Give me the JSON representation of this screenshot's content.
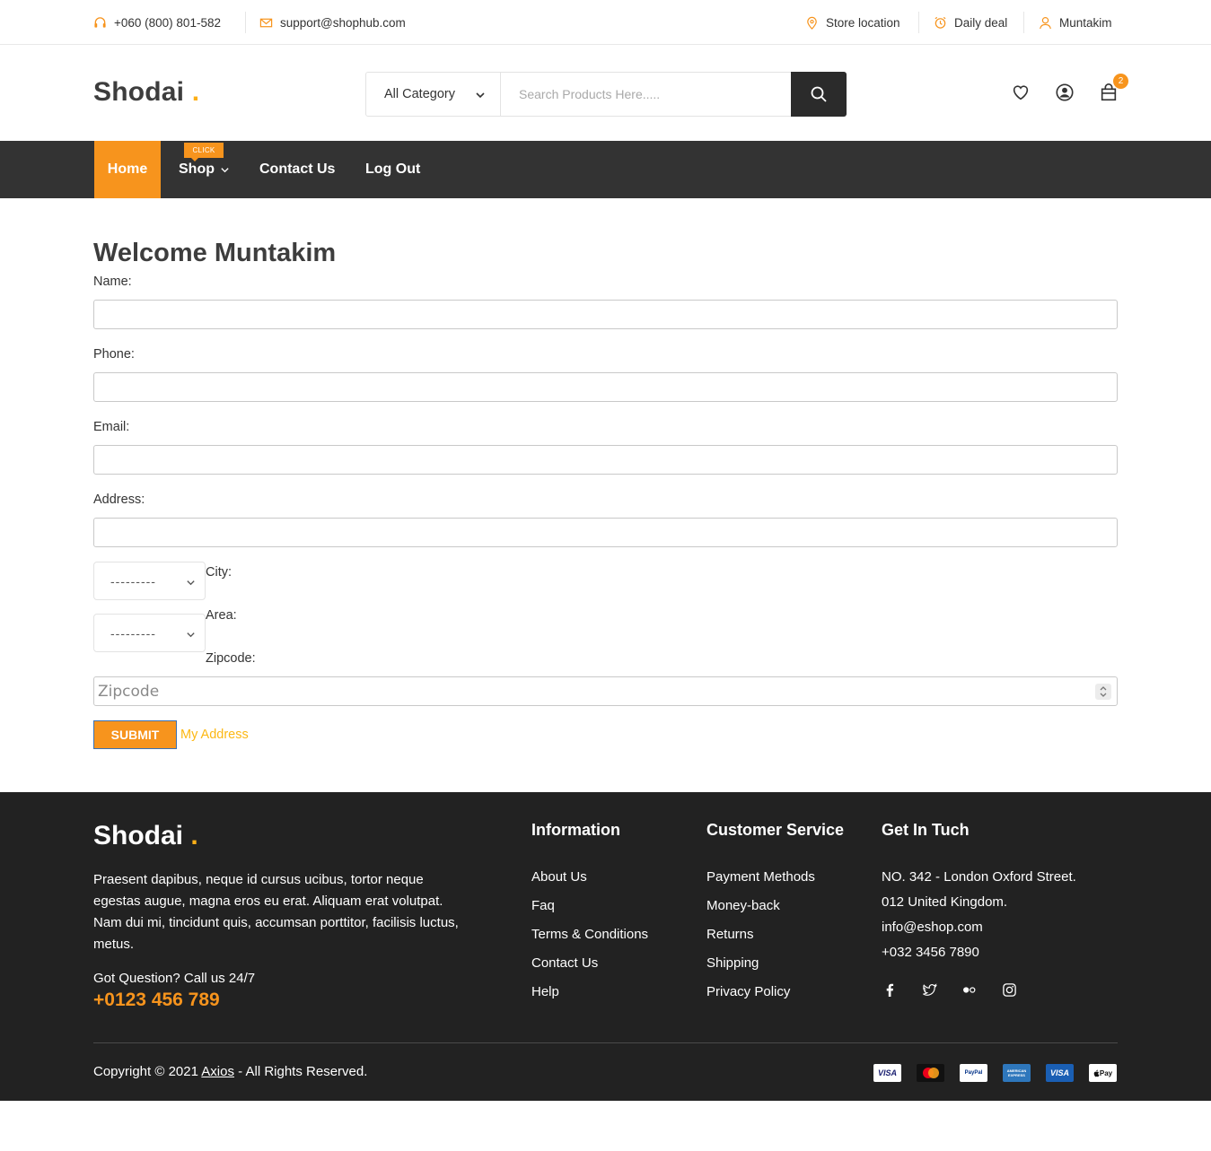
{
  "topbar": {
    "phone": "+060 (800) 801-582",
    "email": "support@shophub.com",
    "store_location": "Store location",
    "daily_deal": "Daily deal",
    "user": "Muntakim"
  },
  "header": {
    "logo": "Shodai",
    "logo_dot": ".",
    "category": "All Category",
    "search_placeholder": "Search Products Here.....",
    "cart_count": "2"
  },
  "nav": {
    "home": "Home",
    "shop": "Shop",
    "shop_badge": "CLICK",
    "contact": "Contact Us",
    "logout": "Log Out"
  },
  "form": {
    "title": "Welcome Muntakim",
    "name_label": "Name:",
    "phone_label": "Phone:",
    "email_label": "Email:",
    "address_label": "Address:",
    "city_select": "---------",
    "city_label": "City:",
    "area_select": "---------",
    "area_label": "Area:",
    "zipcode_label": "Zipcode:",
    "zipcode_placeholder": "Zipcode",
    "submit": "SUBMIT",
    "my_address": "My Address"
  },
  "footer": {
    "logo": "Shodai",
    "logo_dot": ".",
    "about": "Praesent dapibus, neque id cursus ucibus, tortor neque egestas augue, magna eros eu erat. Aliquam erat volutpat. Nam dui mi, tincidunt quis, accumsan porttitor, facilisis luctus, metus.",
    "question": "Got Question? Call us 24/7",
    "phone": "+0123 456 789",
    "information": {
      "title": "Information",
      "links": [
        "About Us",
        "Faq",
        "Terms & Conditions",
        "Contact Us",
        "Help"
      ]
    },
    "customer_service": {
      "title": "Customer Service",
      "links": [
        "Payment Methods",
        "Money-back",
        "Returns",
        "Shipping",
        "Privacy Policy"
      ]
    },
    "contact": {
      "title": "Get In Tuch",
      "lines": [
        "NO. 342 - London Oxford Street.",
        "012 United Kingdom.",
        "info@eshop.com",
        "+032 3456 7890"
      ]
    },
    "social_icons": [
      "facebook-icon",
      "twitter-icon",
      "flickr-icon",
      "instagram-icon"
    ],
    "copyright_prefix": "Copyright © 2021",
    "copyright_brand": "Axios",
    "copyright_suffix": "- All Rights Reserved.",
    "payments": {
      "visa": "VISA",
      "paypal": "PayPal",
      "amex": "AMERICAN EXPRESS",
      "visa2": "VISA",
      "applepay": "Pay"
    }
  },
  "colors": {
    "accent": "#f7941d",
    "logo_dot": "#fcaf17",
    "dark": "#333333",
    "footer_bg": "#222222"
  }
}
